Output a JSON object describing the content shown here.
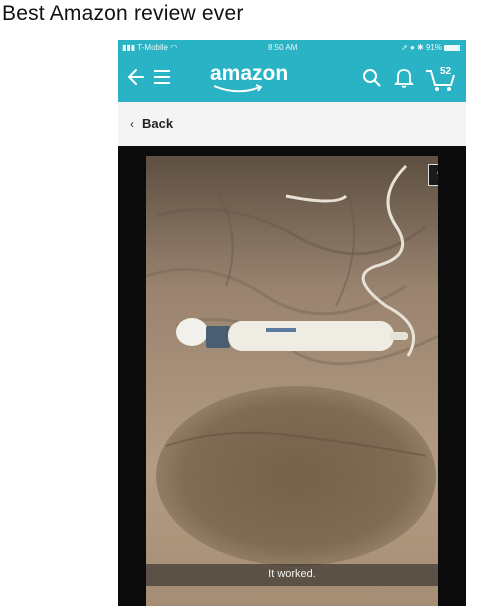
{
  "meme": {
    "caption": "Best Amazon review ever"
  },
  "status_bar": {
    "carrier": "T-Mobile",
    "time": "8:50 AM",
    "battery": "91%"
  },
  "app_bar": {
    "logo": "amazon",
    "cart_count": "52"
  },
  "nav": {
    "back_label": "Back"
  },
  "viewer": {
    "image_counter": "9",
    "photo_caption": "It worked."
  },
  "colors": {
    "app_bar": "#2ab3c4",
    "viewer_bg": "#0b0b0b"
  }
}
